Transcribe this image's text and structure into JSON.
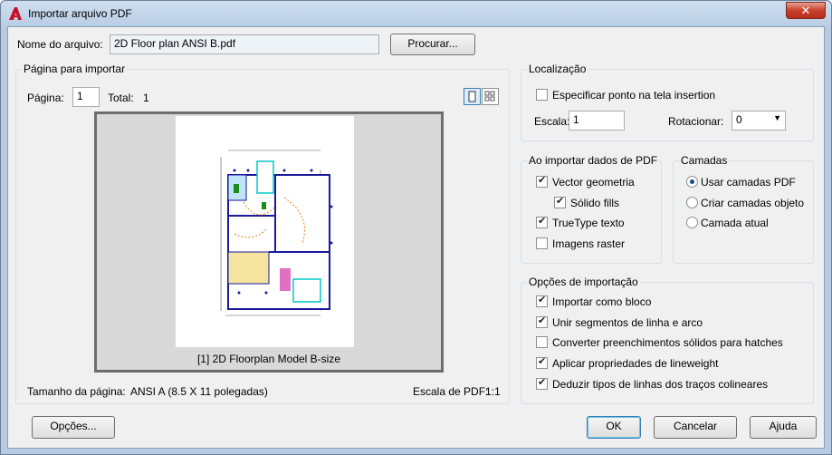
{
  "window": {
    "title": "Importar arquivo PDF",
    "close_label": "✕"
  },
  "file": {
    "label": "Nome do arquivo:",
    "value": "2D Floor plan ANSI B.pdf",
    "browse_label": "Procurar..."
  },
  "page_group": {
    "title": "Página para importar",
    "page_label": "Página:",
    "page_value": "1",
    "total_label": "Total:",
    "total_value": "1",
    "preview_caption": "[1] 2D Floorplan Model B-size",
    "size_label": "Tamanho da página:",
    "size_value": "ANSI A (8.5 X 11 polegadas)",
    "scale_label": "Escala de PDF:",
    "scale_value": "1:1"
  },
  "location": {
    "title": "Localização",
    "specify_label": "Especificar ponto na tela insertion",
    "specify_checked": false,
    "scale_label": "Escala:",
    "scale_value": "1",
    "rotate_label": "Rotacionar:",
    "rotate_value": "0"
  },
  "import_data": {
    "title": "Ao importar dados de PDF",
    "items": [
      {
        "label": "Vector geometria",
        "checked": true
      },
      {
        "label": "Sólido fills",
        "checked": true
      },
      {
        "label": "TrueType texto",
        "checked": true
      },
      {
        "label": "Imagens raster",
        "checked": false
      }
    ]
  },
  "layers": {
    "title": "Camadas",
    "items": [
      {
        "label": "Usar camadas PDF",
        "checked": true
      },
      {
        "label": "Criar camadas objeto",
        "checked": false
      },
      {
        "label": "Camada atual",
        "checked": false
      }
    ]
  },
  "options": {
    "title": "Opções de importação",
    "items": [
      {
        "label": "Importar como bloco",
        "checked": true
      },
      {
        "label": "Unir segmentos de linha e arco",
        "checked": true
      },
      {
        "label": "Converter preenchimentos sólidos para hatches",
        "checked": false
      },
      {
        "label": "Aplicar propriedades de lineweight",
        "checked": true
      },
      {
        "label": "Deduzir tipos de linhas dos traços colineares",
        "checked": true
      }
    ]
  },
  "buttons": {
    "options": "Opções...",
    "ok": "OK",
    "cancel": "Cancelar",
    "help": "Ajuda"
  },
  "colors": {
    "titlebar": "#b9cde4",
    "close": "#c7402c",
    "app_icon": "#c8102e"
  }
}
